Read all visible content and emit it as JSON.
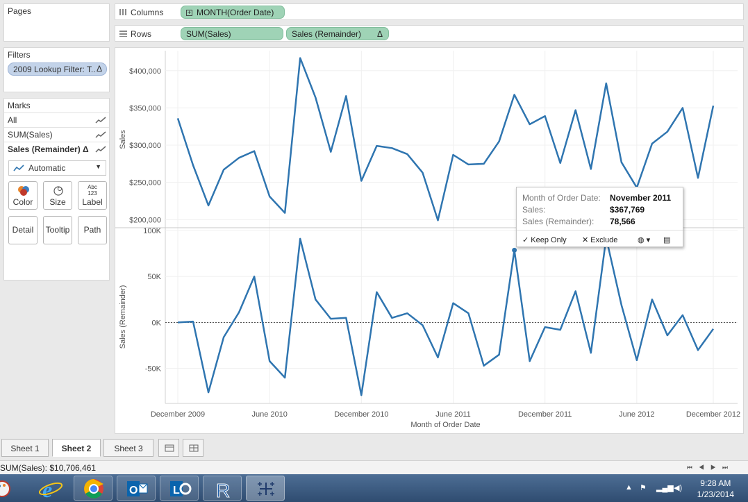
{
  "pages_panel": {
    "title": "Pages"
  },
  "filters_panel": {
    "title": "Filters",
    "filter_label": "2009 Lookup Filter: T..",
    "filter_delta": "Δ"
  },
  "marks_panel": {
    "title": "Marks",
    "rows": [
      {
        "label": "All",
        "bold": false
      },
      {
        "label": "SUM(Sales)",
        "bold": false
      },
      {
        "label": "Sales (Remainder) Δ",
        "bold": true
      }
    ],
    "mark_type": "Automatic",
    "buttons": {
      "color": "Color",
      "size": "Size",
      "label": "Label",
      "label_icon": "Abc 123",
      "detail": "Detail",
      "tooltip": "Tooltip",
      "path": "Path"
    }
  },
  "shelves": {
    "columns_label": "Columns",
    "columns_pill": "MONTH(Order Date)",
    "rows_label": "Rows",
    "rows_pills": [
      "SUM(Sales)",
      "Sales (Remainder)"
    ],
    "rows_delta": "Δ"
  },
  "chart_data": {
    "type": "line",
    "xlabel": "Month of Order Date",
    "x_ticks": [
      "December 2009",
      "June 2010",
      "December 2010",
      "June 2011",
      "December 2011",
      "June 2012",
      "December 2012"
    ],
    "x": [
      "Nov 2009",
      "Dec 2009",
      "Jan 2010",
      "Feb 2010",
      "Mar 2010",
      "Apr 2010",
      "May 2010",
      "Jun 2010",
      "Jul 2010",
      "Aug 2010",
      "Sep 2010",
      "Oct 2010",
      "Nov 2010",
      "Dec 2010",
      "Jan 2011",
      "Feb 2011",
      "Mar 2011",
      "Apr 2011",
      "May 2011",
      "Jun 2011",
      "Jul 2011",
      "Aug 2011",
      "Sep 2011",
      "Oct 2011",
      "Nov 2011",
      "Dec 2011",
      "Jan 2012",
      "Feb 2012",
      "Mar 2012",
      "Apr 2012",
      "May 2012",
      "Jun 2012",
      "Jul 2012",
      "Aug 2012",
      "Sep 2012",
      "Oct 2012",
      "Nov 2012",
      "Dec 2012"
    ],
    "panes": [
      {
        "series": "Sales",
        "ylabel": "Sales",
        "ylim": [
          190000,
          425000
        ],
        "y_ticks": [
          200000,
          250000,
          300000,
          350000,
          400000
        ],
        "y_tick_labels": [
          "$200,000",
          "$250,000",
          "$300,000",
          "$350,000",
          "$400,000"
        ],
        "values": [
          336000,
          273000,
          219000,
          267000,
          283000,
          292000,
          231000,
          209000,
          417000,
          364000,
          291000,
          366000,
          252000,
          299000,
          296000,
          288000,
          263000,
          199000,
          287000,
          274000,
          275000,
          305000,
          367769,
          328000,
          339000,
          276000,
          347000,
          268000,
          383000,
          277000,
          243000,
          302000,
          318000,
          350000,
          256000,
          353000
        ]
      },
      {
        "series": "Sales (Remainder)",
        "ylabel": "Sales (Remainder)",
        "ylim": [
          -88000,
          100000
        ],
        "y_ticks": [
          -50000,
          0,
          50000,
          100000
        ],
        "y_tick_labels": [
          "-50K",
          "0K",
          "50K",
          "100K"
        ],
        "values": [
          0,
          1000,
          -76000,
          -16000,
          11000,
          50000,
          -42000,
          -60000,
          91000,
          25000,
          4000,
          5000,
          -79000,
          33000,
          5000,
          10000,
          -3000,
          -38000,
          21000,
          10000,
          -47000,
          -35000,
          78566,
          -42000,
          -5000,
          -8000,
          34000,
          -33000,
          92000,
          19000,
          -41000,
          25000,
          -14000,
          8000,
          -30000,
          -7000
        ]
      }
    ],
    "highlight_index": 22,
    "line_color": "#2f75b0"
  },
  "tooltip": {
    "rows": [
      {
        "label": "Month of Order Date:",
        "value": "November 2011"
      },
      {
        "label": "Sales:",
        "value": "$367,769"
      },
      {
        "label": "Sales (Remainder):",
        "value": "78,566"
      }
    ],
    "keep_only": "Keep Only",
    "exclude": "Exclude"
  },
  "tabs": [
    "Sheet 1",
    "Sheet 2",
    "Sheet 3"
  ],
  "active_tab": "Sheet 2",
  "status": {
    "text": "SUM(Sales): $10,706,461"
  },
  "taskbar": {
    "time": "9:28 AM",
    "date": "1/23/2014"
  }
}
